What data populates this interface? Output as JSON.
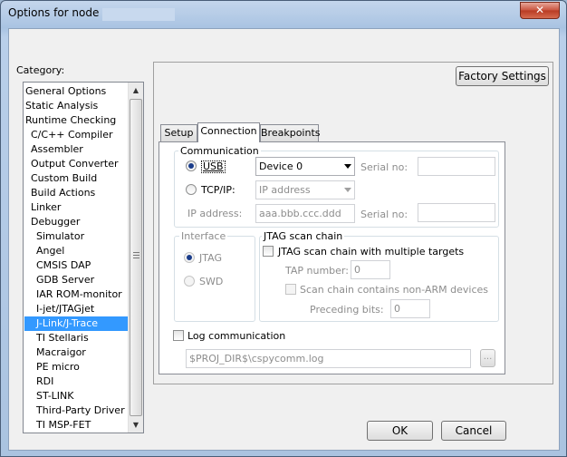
{
  "window": {
    "title": "Options for node '",
    "close_glyph": "✕"
  },
  "category": {
    "label": "Category:",
    "items": [
      {
        "label": "General Options",
        "indent": 0
      },
      {
        "label": "Static Analysis",
        "indent": 0
      },
      {
        "label": "Runtime Checking",
        "indent": 0
      },
      {
        "label": "C/C++ Compiler",
        "indent": 1
      },
      {
        "label": "Assembler",
        "indent": 1
      },
      {
        "label": "Output Converter",
        "indent": 1
      },
      {
        "label": "Custom Build",
        "indent": 1
      },
      {
        "label": "Build Actions",
        "indent": 1
      },
      {
        "label": "Linker",
        "indent": 1
      },
      {
        "label": "Debugger",
        "indent": 1
      },
      {
        "label": "Simulator",
        "indent": 2
      },
      {
        "label": "Angel",
        "indent": 2
      },
      {
        "label": "CMSIS DAP",
        "indent": 2
      },
      {
        "label": "GDB Server",
        "indent": 2
      },
      {
        "label": "IAR ROM-monitor",
        "indent": 2
      },
      {
        "label": "I-jet/JTAGjet",
        "indent": 2
      },
      {
        "label": "J-Link/J-Trace",
        "indent": 2,
        "selected": true
      },
      {
        "label": "TI Stellaris",
        "indent": 2
      },
      {
        "label": "Macraigor",
        "indent": 2
      },
      {
        "label": "PE micro",
        "indent": 2
      },
      {
        "label": "RDI",
        "indent": 2
      },
      {
        "label": "ST-LINK",
        "indent": 2
      },
      {
        "label": "Third-Party Driver",
        "indent": 2
      },
      {
        "label": "TI MSP-FET",
        "indent": 2
      }
    ]
  },
  "buttons": {
    "factory_settings": "Factory Settings",
    "ok": "OK",
    "cancel": "Cancel"
  },
  "tabs": [
    {
      "label": "Setup",
      "active": false
    },
    {
      "label": "Connection",
      "active": true
    },
    {
      "label": "Breakpoints",
      "active": false
    }
  ],
  "communication": {
    "title": "Communication",
    "usb_label": "USB",
    "usb_selected": true,
    "usb_device": "Device 0",
    "serial_label": "Serial no:",
    "tcpip_label": "TCP/IP:",
    "tcpip_mode": "IP address",
    "ip_label": "IP address:",
    "ip_placeholder": "aaa.bbb.ccc.ddd",
    "serial_label2": "Serial no:"
  },
  "interface": {
    "title": "Interface",
    "jtag": "JTAG",
    "swd": "SWD"
  },
  "jtag_chain": {
    "title": "JTAG scan chain",
    "multi_targets": "JTAG scan chain with multiple targets",
    "tap_label": "TAP number:",
    "tap_value": "0",
    "non_arm": "Scan chain contains non-ARM devices",
    "preceding_label": "Preceding bits:",
    "preceding_value": "0"
  },
  "log": {
    "label": "Log communication",
    "path": "$PROJ_DIR$\\cspycomm.log",
    "browse": "..."
  },
  "colors": {
    "selection": "#3399ff",
    "close_button": "#c9533d"
  }
}
